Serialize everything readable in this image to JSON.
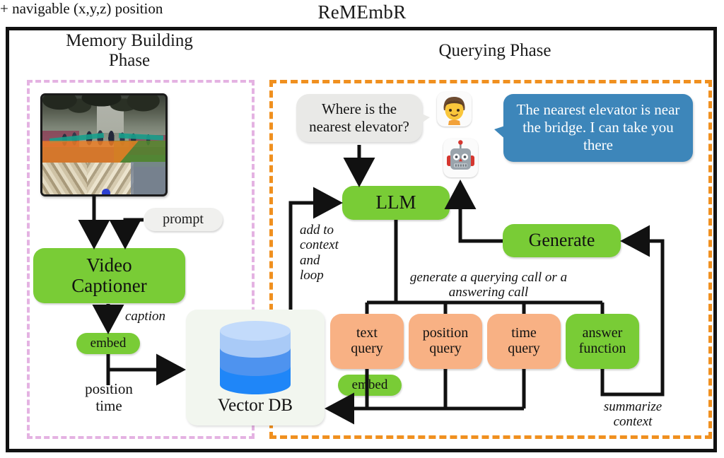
{
  "title": "ReMEmbR",
  "phases": {
    "memory_building": "Memory Building\nPhase",
    "memory_building_line1": "Memory Building",
    "memory_building_line2": "Phase",
    "querying": "Querying Phase"
  },
  "memory_phase": {
    "video_thumbnail_name": "segmented-campus-video-frame",
    "prompt_label": "prompt",
    "video_captioner_line1": "Video",
    "video_captioner_line2": "Captioner",
    "caption_label": "caption",
    "embed_label": "embed",
    "position_time_line1": "position",
    "position_time_line2": "time",
    "vector_db_label": "Vector DB"
  },
  "query_phase": {
    "user_question": "Where is the nearest elevator?",
    "bot_answer": "The nearest elevator is near the bridge. I can take you there",
    "navigable_note": "+ navigable (x,y,z) position",
    "llm_label": "LLM",
    "generate_label": "Generate",
    "add_to_context_loop": "add to context and loop",
    "generate_call_note": "generate a querying call or a answering call",
    "summarize_context_note": "summarize context",
    "embed_label": "embed",
    "tools": [
      {
        "line1": "text",
        "line2": "query",
        "color": "orange"
      },
      {
        "line1": "position",
        "line2": "query",
        "color": "orange"
      },
      {
        "line1": "time",
        "line2": "query",
        "color": "orange"
      },
      {
        "line1": "answer",
        "line2": "function",
        "color": "green"
      }
    ]
  },
  "icons": {
    "user_avatar": "person-emoji-icon",
    "robot_avatar": "robot-emoji-icon",
    "database": "database-cylinder-icon"
  },
  "colors": {
    "green_node": "#79cc36",
    "orange_node": "#f8b184",
    "bot_bubble_blue": "#3d86ba",
    "user_bubble_grey": "#e9e9e7",
    "memory_dashed": "#e4b2e2",
    "query_dashed": "#f0901f",
    "db_light": "#a9caf7",
    "db_mid": "#4e93ef",
    "db_dark": "#1f86f8",
    "frame": "#111111"
  }
}
